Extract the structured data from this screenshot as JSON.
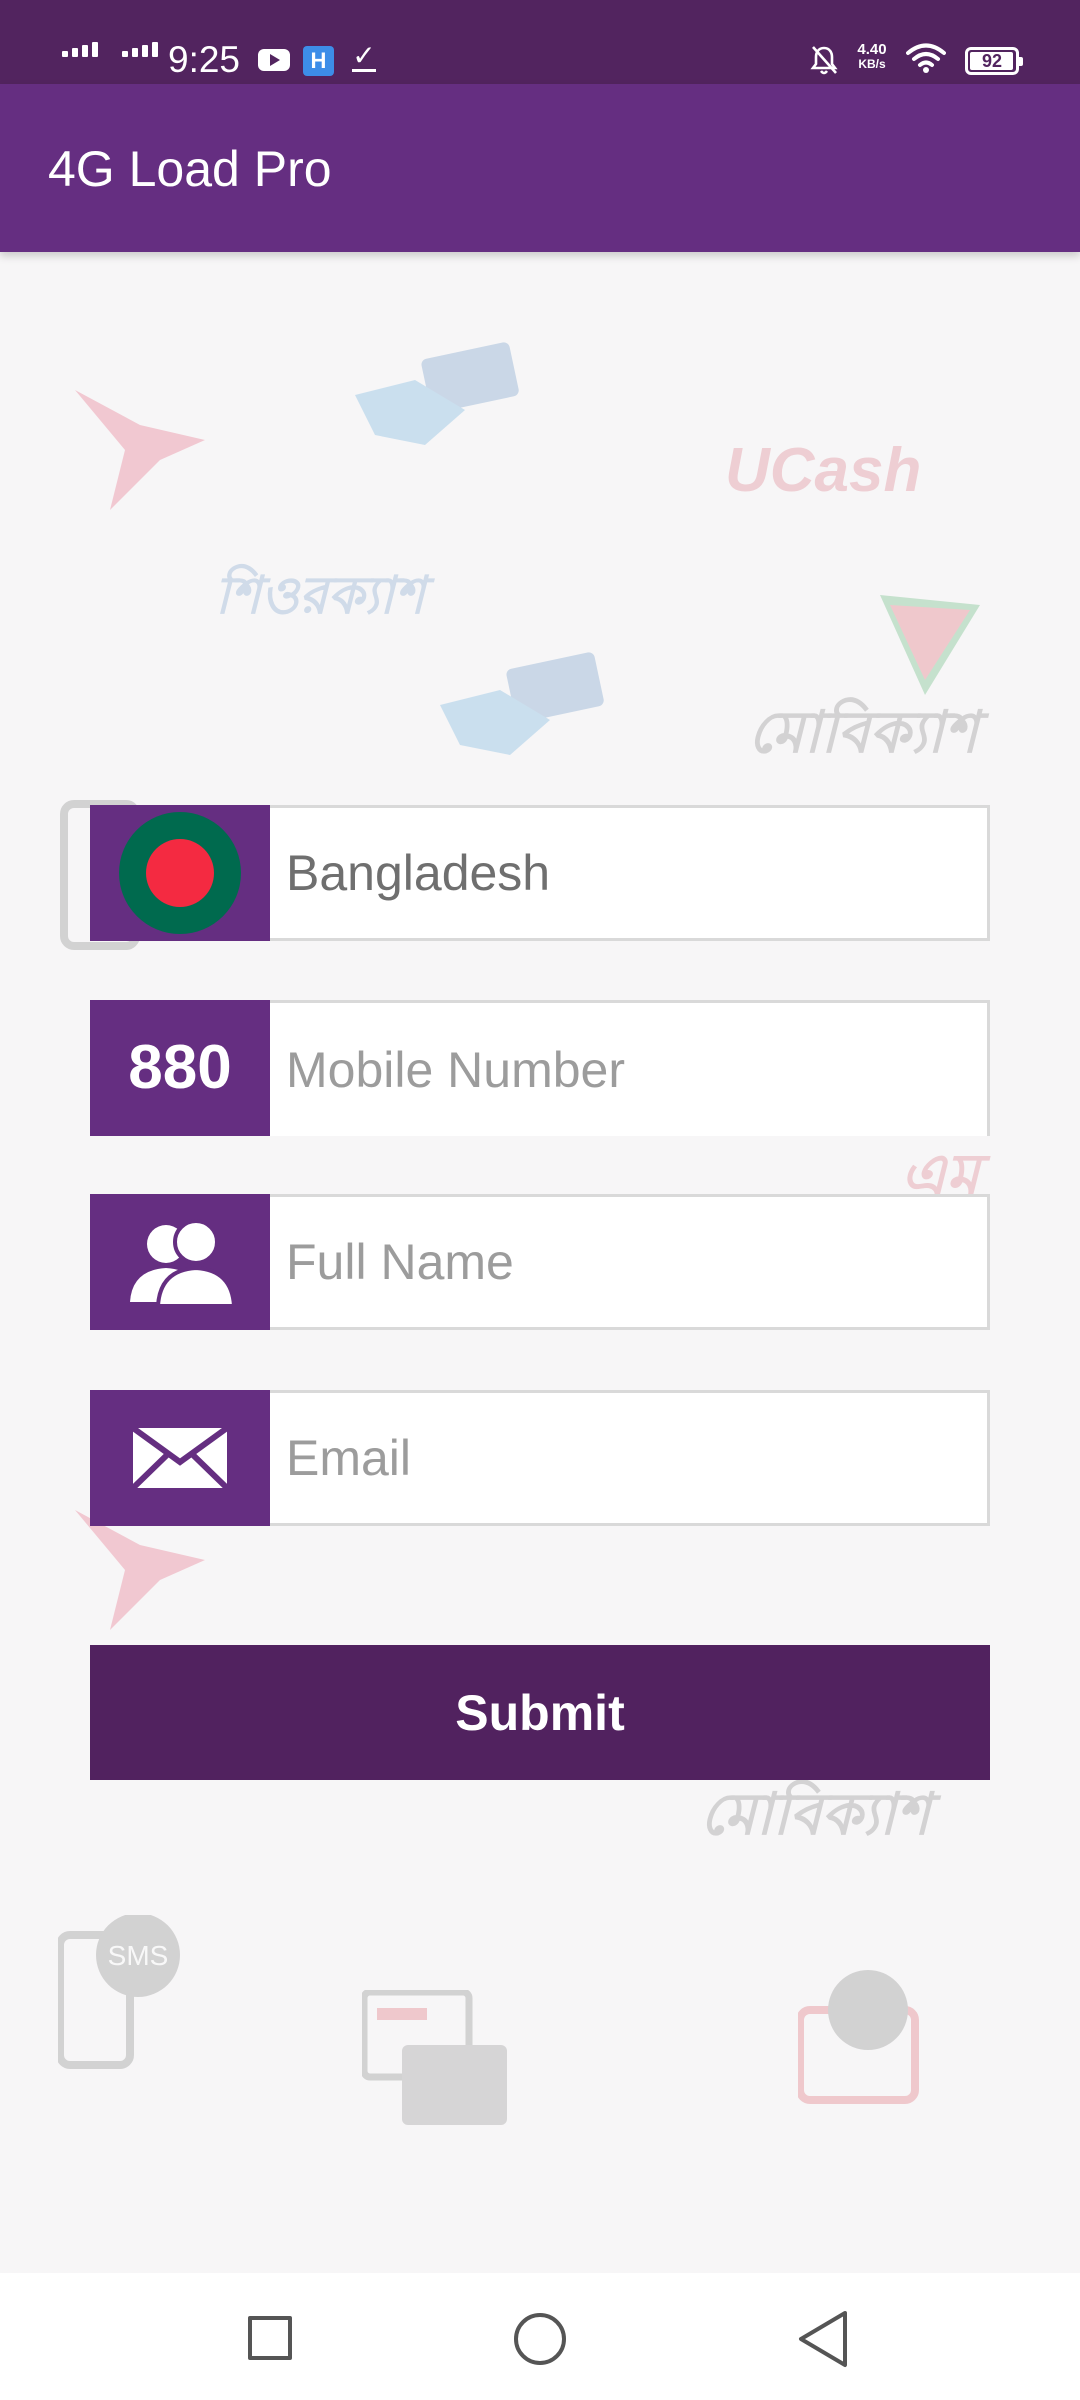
{
  "status_bar": {
    "time": "9:25",
    "net_speed_value": "4.40",
    "net_speed_unit": "KB/s",
    "battery": "92",
    "icons": [
      "signal-icon",
      "youtube-icon",
      "h-app-icon",
      "download-done-icon",
      "mute-icon",
      "wifi-icon",
      "battery-icon"
    ]
  },
  "app_bar": {
    "title": "4G Load Pro"
  },
  "form": {
    "country": {
      "value": "Bangladesh",
      "icon": "bangladesh-flag-icon"
    },
    "mobile": {
      "code": "880",
      "placeholder": "Mobile Number"
    },
    "full_name": {
      "placeholder": "Full Name",
      "icon": "users-icon"
    },
    "email": {
      "placeholder": "Email",
      "icon": "envelope-icon"
    },
    "submit_label": "Submit"
  },
  "background": {
    "watermarks": [
      "UCash",
      "শিওরক্যাশ",
      "মোবিক্যাশ",
      "এম",
      "মোবিক্যাশ",
      "SMS"
    ]
  },
  "nav_bar": {
    "icons": [
      "recent-apps-icon",
      "home-icon",
      "back-icon"
    ]
  },
  "colors": {
    "status_bar": "#52245f",
    "app_bar": "#652e81",
    "submit": "#51225f",
    "flag_green": "#006a4e",
    "flag_red": "#f42a41"
  }
}
